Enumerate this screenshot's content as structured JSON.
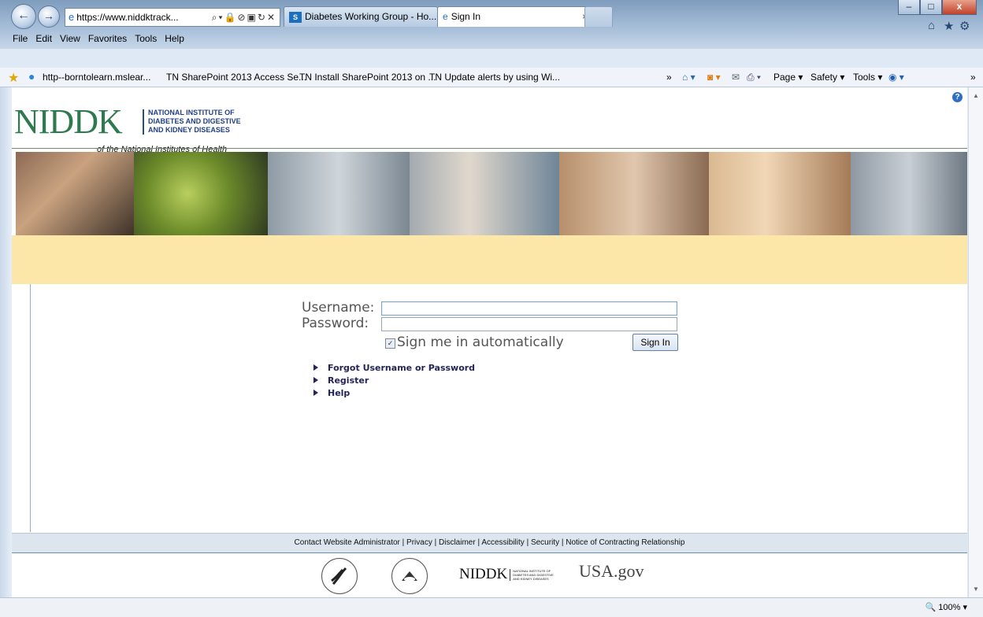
{
  "browser": {
    "address": {
      "protocol": "https://",
      "host": "www.niddktrack..."
    },
    "tabs": [
      {
        "label": "Diabetes Working Group - Ho...",
        "icon": "sharepoint-icon"
      },
      {
        "label": "Sign In",
        "icon": "ie-icon",
        "close": "×"
      }
    ],
    "menu": [
      "File",
      "Edit",
      "View",
      "Favorites",
      "Tools",
      "Help"
    ],
    "favorites": [
      "http--borntolearn.mslear...",
      "TN SharePoint 2013 Access Se...",
      "TN Install SharePoint 2013 on ...",
      "TN Update alerts by using Wi..."
    ],
    "favorites_overflow": "»",
    "command_bar": {
      "page": "Page ▾",
      "safety": "Safety ▾",
      "tools": "Tools ▾"
    },
    "window_buttons": {
      "minimize": "–",
      "maximize": "□",
      "close": "x"
    },
    "zoom": "100%"
  },
  "header": {
    "logo_acronym": "NIDDK",
    "logo_line1": "NATIONAL INSTITUTE OF",
    "logo_line2": "DIABETES AND DIGESTIVE",
    "logo_line3": "AND KIDNEY DISEASES",
    "logo_sub": "of the National Institutes of Health"
  },
  "login": {
    "username_label": "Username:",
    "password_label": "Password:",
    "username_value": "",
    "password_value": "",
    "remember_label": "Sign me in automatically",
    "remember_checked": true,
    "sign_in_button": "Sign In"
  },
  "links": [
    "Forgot Username or Password",
    "Register",
    "Help"
  ],
  "footer": {
    "links": [
      "Contact Website Administrator",
      "Privacy",
      "Disclaimer",
      "Accessibility",
      "Security",
      "Notice of Contracting Relationship"
    ],
    "separator": "|",
    "niddk_logo": "NIDDK",
    "usa_logo": "USA.gov"
  },
  "colors": {
    "banner_band": "#fde7a8",
    "logo_green": "#2e7a4e",
    "logo_blue": "#1f3f86",
    "link_color": "#22255a"
  }
}
